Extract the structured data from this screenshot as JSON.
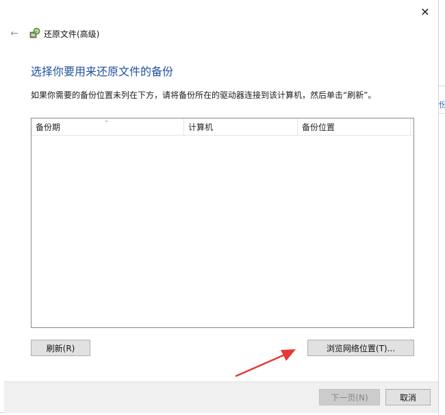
{
  "window": {
    "title": "还原文件(高级)",
    "close_label": "✕",
    "back_label": "←"
  },
  "main": {
    "heading": "选择你要用来还原文件的备份",
    "instruction": "如果你需要的备份位置未列在下方，请将备份所在的驱动器连接到该计算机，然后单击“刷新”。"
  },
  "table": {
    "columns": [
      "备份期",
      "计算机",
      "备份位置"
    ],
    "rows": []
  },
  "buttons": {
    "refresh": "刷新(R)",
    "browse": "浏览网络位置(T)...",
    "next": "下一页(N)",
    "cancel": "取消"
  },
  "background_window": {
    "peek_text": "份"
  },
  "colors": {
    "heading": "#1f4e9e",
    "annotation_arrow": "#e53935"
  }
}
